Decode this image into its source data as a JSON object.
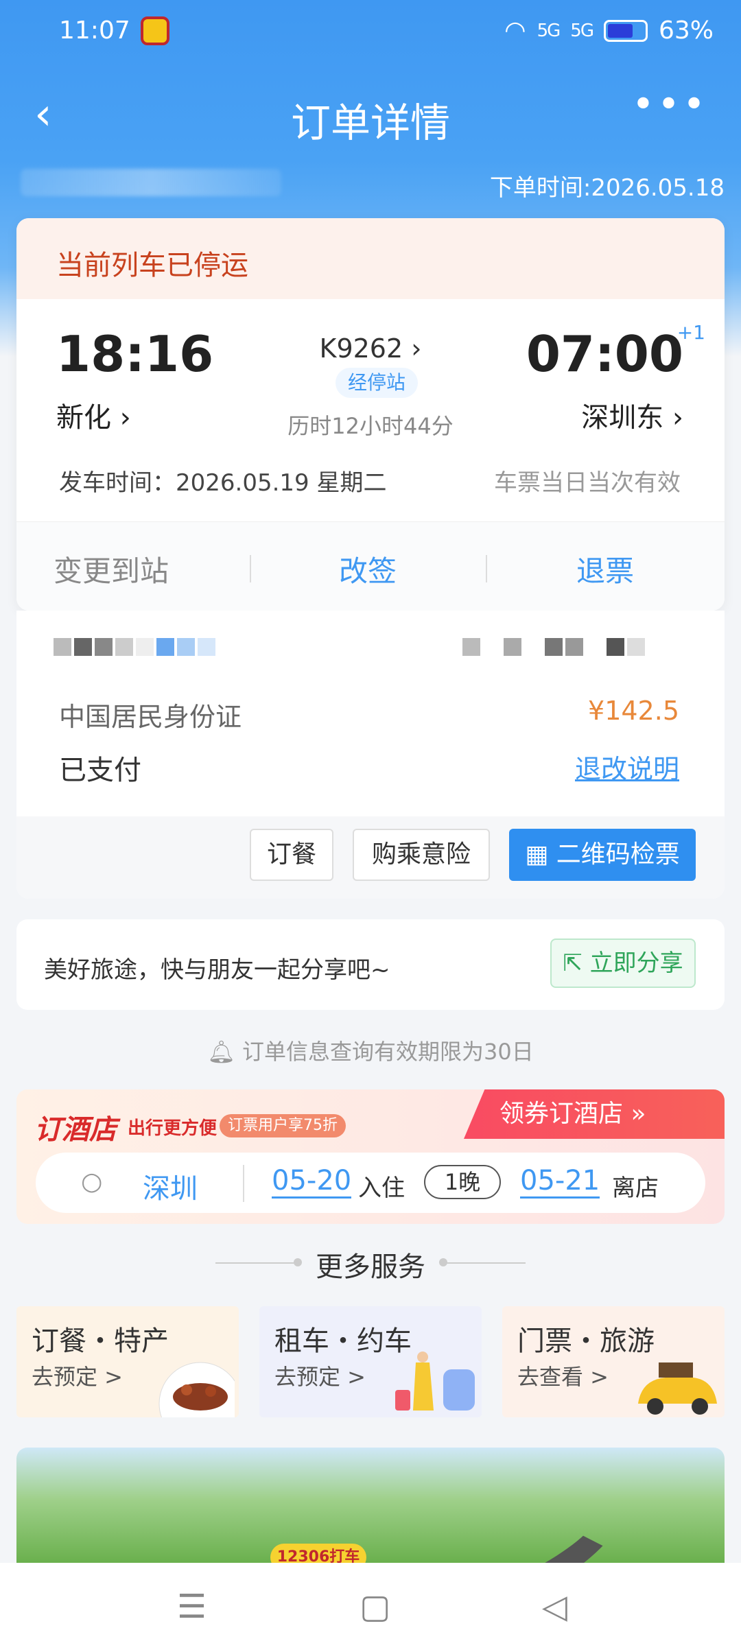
{
  "status": {
    "time": "11:07",
    "battery": "63%",
    "signal1": "5G",
    "signal2": "5G"
  },
  "nav": {
    "title": "订单详情",
    "back_icon": "‹",
    "more_icon": "•••"
  },
  "order_time": "下单时间:2026.05.18",
  "train": {
    "alert": "当前列车已停运",
    "depart_time": "18:16",
    "depart_station": "新化",
    "train_no": "K9262",
    "via_label": "经停站",
    "duration": "历时12小时44分",
    "arrive_time": "07:00",
    "arrive_plus": "+1",
    "arrive_station": "深圳东",
    "depart_date": "发车时间：2026.05.19 星期二",
    "validity": "车票当日当次有效",
    "actions": {
      "change_station": "变更到站",
      "reschedule": "改签",
      "refund": "退票"
    }
  },
  "passenger": {
    "id_type": "中国居民身份证",
    "price": "¥142.5",
    "status": "已支付",
    "rules_link": "退改说明",
    "buttons": {
      "meal": "订餐",
      "insurance": "购乘意险",
      "qr": "二维码检票"
    }
  },
  "share": {
    "text": "美好旅途，快与朋友一起分享吧~",
    "button": "立即分享"
  },
  "notice": "订单信息查询有效期限为30日",
  "hotel": {
    "logo": "订酒店",
    "tagline": "出行更方便",
    "badge": "订票用户享75折",
    "cta": "领券订酒店 »",
    "city": "深圳",
    "checkin_date": "05-20",
    "checkin_label": "入住",
    "nights": "1晚",
    "checkout_date": "05-21",
    "checkout_label": "离店"
  },
  "more_services": {
    "title": "更多服务",
    "items": [
      {
        "title": "订餐・特产",
        "sub": "去预定 >"
      },
      {
        "title": "租车・约车",
        "sub": "去预定 >"
      },
      {
        "title": "门票・旅游",
        "sub": "去查看 >"
      }
    ]
  },
  "banner": {
    "label": "12306打车"
  },
  "colors": {
    "primary": "#3f98f2",
    "alert": "#c8421e",
    "price": "#e8883a",
    "share": "#2fa55a",
    "hotel": "#d92b2b"
  }
}
